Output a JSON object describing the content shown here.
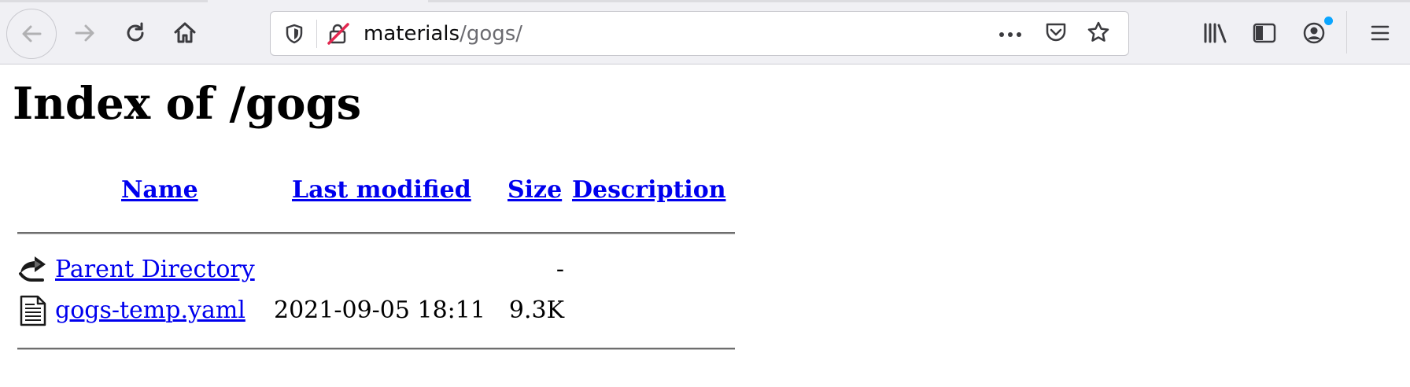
{
  "browser": {
    "url": {
      "host": "materials",
      "path": "/gogs/"
    },
    "buttons": {
      "back": "back-arrow-icon",
      "forward": "forward-arrow-icon",
      "reload": "reload-icon",
      "home": "home-icon",
      "page_actions": "more-horizontal-icon",
      "pocket": "pocket-icon",
      "bookmark": "star-icon",
      "library": "library-icon",
      "sidebar": "sidebar-icon",
      "account": "account-icon",
      "menu": "hamburger-menu-icon"
    },
    "colors": {
      "toolbar_bg": "#f0f0f4",
      "notification_dot": "#0aa5ff",
      "insecure_red": "#e22850"
    }
  },
  "page": {
    "title": "Index of /gogs",
    "columns": {
      "name": "Name",
      "last_modified": "Last modified",
      "size": "Size",
      "description": "Description"
    },
    "rows": [
      {
        "icon": "back-folder-icon",
        "name": "Parent Directory",
        "last_modified": "",
        "size": "-",
        "description": ""
      },
      {
        "icon": "text-file-icon",
        "name": "gogs-temp.yaml",
        "last_modified": "2021-09-05 18:11",
        "size": "9.3K",
        "description": ""
      }
    ],
    "colors": {
      "link": "#0000ee"
    }
  }
}
